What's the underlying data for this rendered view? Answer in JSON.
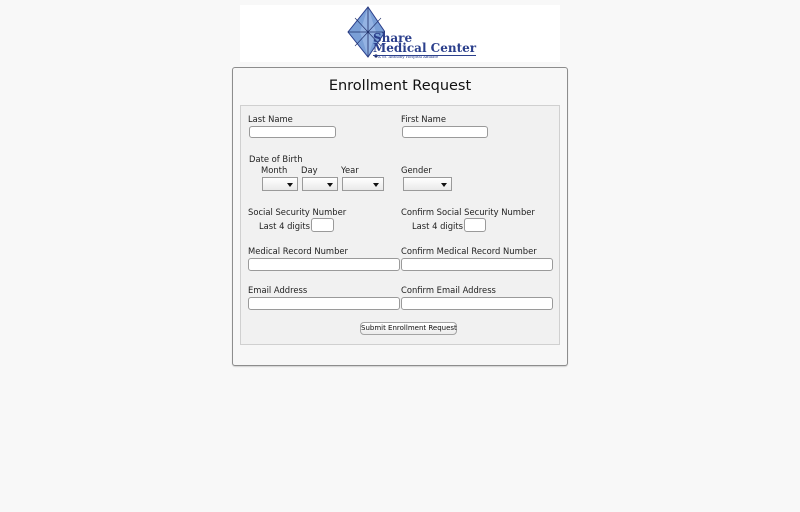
{
  "logo": {
    "line1": "Share",
    "line2": "Medical Center",
    "subtitle": "A St. Anthony Hospital Affiliate"
  },
  "form": {
    "title": "Enrollment Request",
    "last_name": {
      "label": "Last Name",
      "value": ""
    },
    "first_name": {
      "label": "First Name",
      "value": ""
    },
    "dob": {
      "label": "Date of Birth",
      "month_label": "Month",
      "day_label": "Day",
      "year_label": "Year",
      "month_value": "",
      "day_value": "",
      "year_value": ""
    },
    "gender": {
      "label": "Gender",
      "value": ""
    },
    "ssn": {
      "label": "Social Security Number",
      "sublabel": "Last 4 digits",
      "value": ""
    },
    "confirm_ssn": {
      "label": "Confirm Social Security Number",
      "sublabel": "Last 4 digits",
      "value": ""
    },
    "mrn": {
      "label": "Medical Record Number",
      "value": ""
    },
    "confirm_mrn": {
      "label": "Confirm Medical Record Number",
      "value": ""
    },
    "email": {
      "label": "Email Address",
      "value": ""
    },
    "confirm_email": {
      "label": "Confirm Email Address",
      "value": ""
    },
    "submit_label": "Submit Enrollment Request"
  },
  "colors": {
    "logo_blue": "#2b3f8c",
    "logo_diamond": "#7a9fd6",
    "page_background": "#f8f8f8"
  }
}
